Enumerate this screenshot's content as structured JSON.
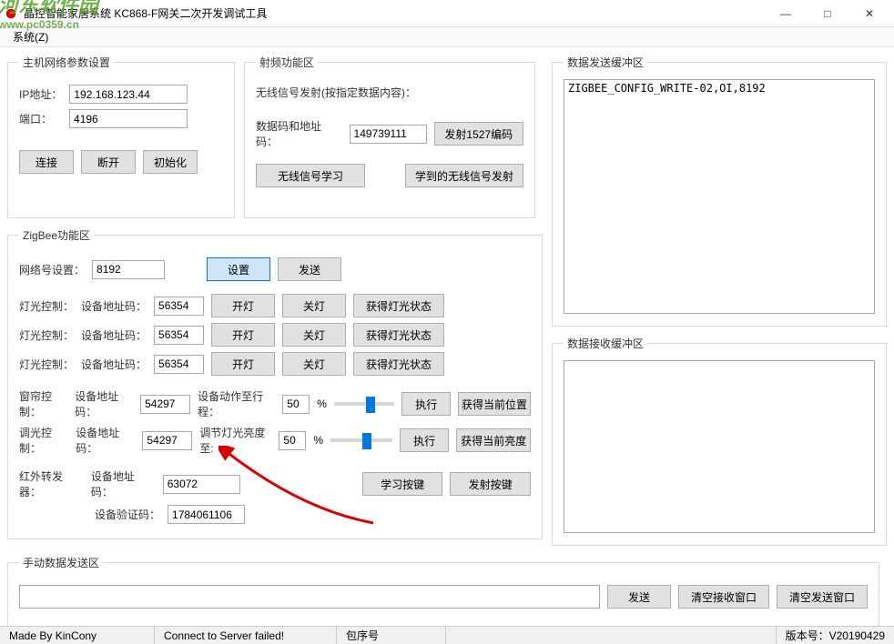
{
  "window": {
    "title": "晶控智能家居系统 KC868-F网关二次开发调试工具",
    "min": "—",
    "max": "□",
    "close": "✕"
  },
  "menu": {
    "system": "系统(Z)"
  },
  "watermark": {
    "line1": "河东软件园",
    "line2": "www.pc0359.cn"
  },
  "host": {
    "legend": "主机网络参数设置",
    "ip_label": "IP地址：",
    "ip": "192.168.123.44",
    "port_label": "端口：",
    "port": "4196",
    "connect": "连接",
    "disconnect": "断开",
    "init": "初始化"
  },
  "rf": {
    "legend": "射频功能区",
    "send_label": "无线信号发射(按指定数据内容)：",
    "code_label": "数据码和地址码：",
    "code": "149739111",
    "btn_1527": "发射1527编码",
    "btn_learn": "无线信号学习",
    "btn_emit": "学到的无线信号发射"
  },
  "send_buf": {
    "legend": "数据发送缓冲区",
    "content": "ZIGBEE_CONFIG_WRITE-02,OI,8192"
  },
  "recv_buf": {
    "legend": "数据接收缓冲区",
    "content": ""
  },
  "zigbee": {
    "legend": "ZigBee功能区",
    "netid_label": "网络号设置：",
    "netid": "8192",
    "set": "设置",
    "send": "发送",
    "light_label": "灯光控制：",
    "addr_label": "设备地址码：",
    "addr1": "56354",
    "addr2": "56354",
    "addr3": "56354",
    "on": "开灯",
    "off": "关灯",
    "get_light": "获得灯光状态",
    "curtain_label": "窗帘控制：",
    "curtain_addr": "54297",
    "curtain_action_label": "设备动作至行程：",
    "curtain_val": "50",
    "percent": "%",
    "exec": "执行",
    "get_pos": "获得当前位置",
    "dimmer_label": "调光控制：",
    "dimmer_addr": "54297",
    "dimmer_action_label": "调节灯光亮度至:",
    "dimmer_val": "50",
    "get_brightness": "获得当前亮度",
    "ir_label": "红外转发器：",
    "ir_addr_label": "设备地址码：",
    "ir_addr": "63072",
    "ir_verify_label": "设备验证码：",
    "ir_verify": "1784061106",
    "learn_key": "学习按键",
    "emit_key": "发射按键"
  },
  "manual": {
    "legend": "手动数据发送区",
    "input": "",
    "send": "发送",
    "clear_recv": "清空接收窗口",
    "clear_send": "清空发送窗口"
  },
  "status": {
    "made": "Made By KinCony",
    "conn": "Connect to Server failed!",
    "pkg": "包序号",
    "ver": "版本号：V20190429"
  }
}
